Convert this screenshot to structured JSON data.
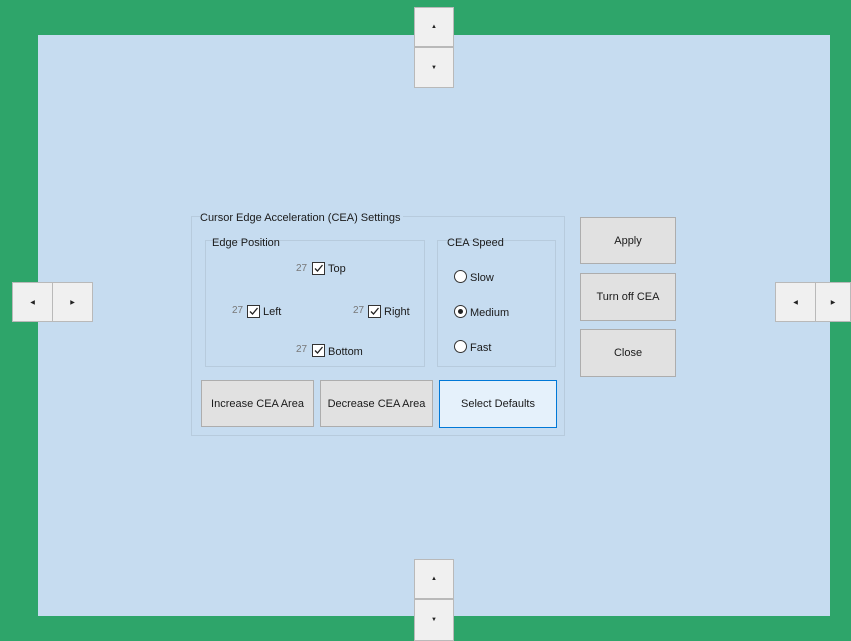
{
  "panel": {
    "title": "Cursor Edge Acceleration (CEA) Settings",
    "edge_position": {
      "title": "Edge Position",
      "top": {
        "value": "27",
        "label": "Top",
        "checked": true
      },
      "left": {
        "value": "27",
        "label": "Left",
        "checked": true
      },
      "right": {
        "value": "27",
        "label": "Right",
        "checked": true
      },
      "bottom": {
        "value": "27",
        "label": "Bottom",
        "checked": true
      }
    },
    "speed": {
      "title": "CEA Speed",
      "options": [
        {
          "label": "Slow",
          "selected": false
        },
        {
          "label": "Medium",
          "selected": true
        },
        {
          "label": "Fast",
          "selected": false
        }
      ]
    },
    "buttons": {
      "increase": "Increase CEA Area",
      "decrease": "Decrease CEA Area",
      "defaults": "Select Defaults"
    }
  },
  "side_buttons": {
    "apply": "Apply",
    "turn_off": "Turn off CEA",
    "close": "Close"
  },
  "colors": {
    "border": "#2ea56a",
    "background": "#c6dcf0",
    "focus": "#0078d7"
  }
}
